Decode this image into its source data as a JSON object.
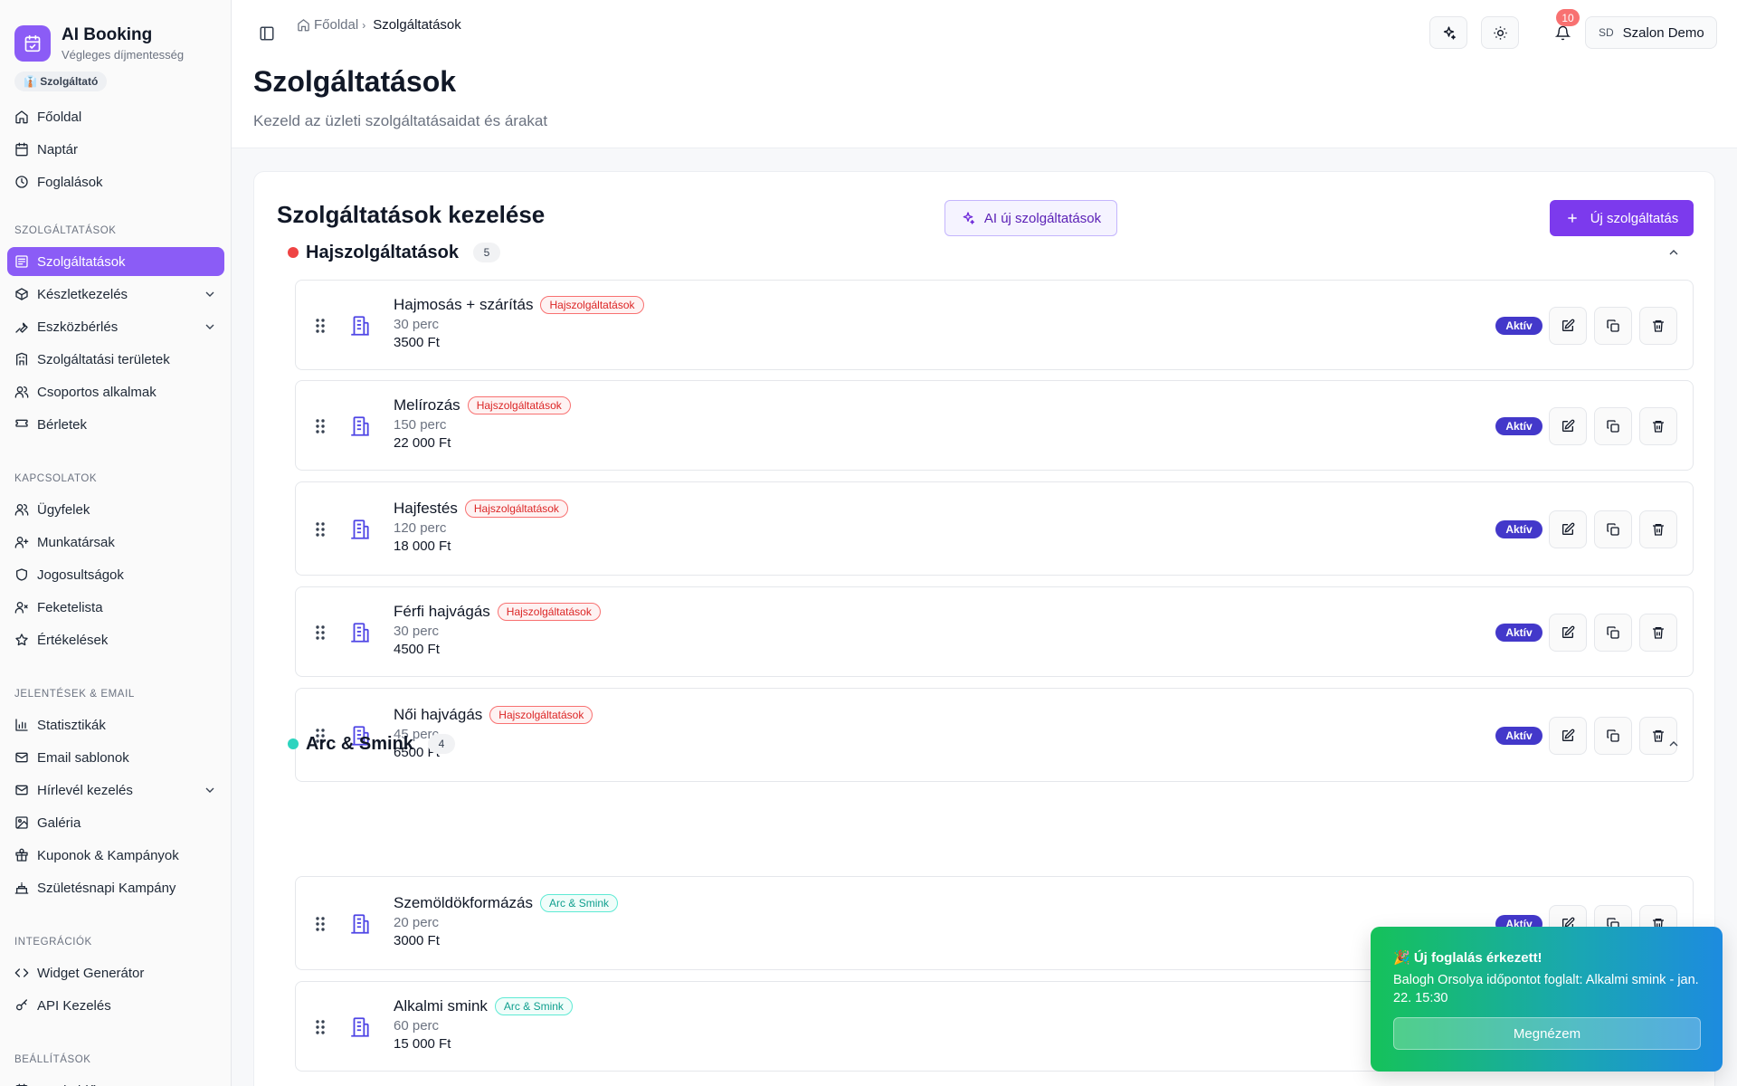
{
  "brand": {
    "title": "AI Booking",
    "subtitle": "Végleges díjmentesség",
    "role": "👔 Szolgáltató"
  },
  "sidebar": {
    "top": [
      {
        "label": "Főoldal",
        "icon": "home-icon"
      },
      {
        "label": "Naptár",
        "icon": "calendar-icon"
      },
      {
        "label": "Foglalások",
        "icon": "clock-icon"
      }
    ],
    "sections": [
      {
        "title": "SZOLGÁLTATÁSOK",
        "items": [
          {
            "label": "Szolgáltatások",
            "icon": "services-icon",
            "active": true
          },
          {
            "label": "Készletkezelés",
            "icon": "box-icon",
            "expandable": true
          },
          {
            "label": "Eszközbérlés",
            "icon": "wrench-icon",
            "expandable": true
          },
          {
            "label": "Szolgáltatási területek",
            "icon": "building-icon"
          },
          {
            "label": "Csoportos alkalmak",
            "icon": "users-icon"
          },
          {
            "label": "Bérletek",
            "icon": "ticket-icon"
          }
        ]
      },
      {
        "title": "KAPCSOLATOK",
        "items": [
          {
            "label": "Ügyfelek",
            "icon": "users-icon"
          },
          {
            "label": "Munkatársak",
            "icon": "user-plus-icon"
          },
          {
            "label": "Jogosultságok",
            "icon": "shield-icon"
          },
          {
            "label": "Feketelista",
            "icon": "user-x-icon"
          },
          {
            "label": "Értékelések",
            "icon": "star-icon"
          }
        ]
      },
      {
        "title": "JELENTÉSEK & EMAIL",
        "items": [
          {
            "label": "Statisztikák",
            "icon": "bar-chart-icon"
          },
          {
            "label": "Email sablonok",
            "icon": "mail-icon"
          },
          {
            "label": "Hírlevél kezelés",
            "icon": "mail-icon",
            "expandable": true
          },
          {
            "label": "Galéria",
            "icon": "image-icon"
          },
          {
            "label": "Kuponok & Kampányok",
            "icon": "gift-icon"
          },
          {
            "label": "Születésnapi Kampány",
            "icon": "cake-icon"
          }
        ]
      },
      {
        "title": "INTEGRÁCIÓK",
        "items": [
          {
            "label": "Widget Generátor",
            "icon": "code-icon"
          },
          {
            "label": "API Kezelés",
            "icon": "key-icon"
          }
        ]
      },
      {
        "title": "BEÁLLÍTÁSOK",
        "items": [
          {
            "label": "Munkaidő",
            "icon": "calendar-icon"
          }
        ]
      }
    ]
  },
  "header": {
    "breadcrumb_home": "Főoldal",
    "breadcrumb_current": "Szolgáltatások",
    "notification_count": "10",
    "user_initials": "SD",
    "user_name": "Szalon Demo",
    "page_title": "Szolgáltatások",
    "page_subtitle": "Kezeld az üzleti szolgáltatásaidat és árakat"
  },
  "main": {
    "card_title": "Szolgáltatások kezelése",
    "ai_button": "AI új szolgáltatások",
    "new_button": "Új szolgáltatás",
    "categories": [
      {
        "name": "Hajszolgáltatások",
        "count": "5",
        "color": "#ef4444",
        "tag_style": "red",
        "services": [
          {
            "name": "Hajmosás + szárítás",
            "tag": "Hajszolgáltatások",
            "duration": "30 perc",
            "price": "3500 Ft",
            "status": "Aktív"
          },
          {
            "name": "Melírozás",
            "tag": "Hajszolgáltatások",
            "duration": "150 perc",
            "price": "22 000 Ft",
            "status": "Aktív"
          },
          {
            "name": "Hajfestés",
            "tag": "Hajszolgáltatások",
            "duration": "120 perc",
            "price": "18 000 Ft",
            "status": "Aktív"
          },
          {
            "name": "Férfi hajvágás",
            "tag": "Hajszolgáltatások",
            "duration": "30 perc",
            "price": "4500 Ft",
            "status": "Aktív"
          },
          {
            "name": "Női hajvágás",
            "tag": "Hajszolgáltatások",
            "duration": "45 perc",
            "price": "6500 Ft",
            "status": "Aktív"
          }
        ]
      },
      {
        "name": "Arc & Smink",
        "count": "4",
        "color": "#2dd4bf",
        "tag_style": "teal",
        "services": [
          {
            "name": "Szemöldökformázás",
            "tag": "Arc & Smink",
            "duration": "20 perc",
            "price": "3000 Ft",
            "status": "Aktív"
          },
          {
            "name": "Alkalmi smink",
            "tag": "Arc & Smink",
            "duration": "60 perc",
            "price": "15 000 Ft",
            "status": ""
          }
        ]
      }
    ]
  },
  "toast": {
    "title": "🎉 Új foglalás érkezett!",
    "message": "Balogh Orsolya időpontot foglalt: Alkalmi smink - jan. 22. 15:30",
    "button": "Megnézem"
  }
}
